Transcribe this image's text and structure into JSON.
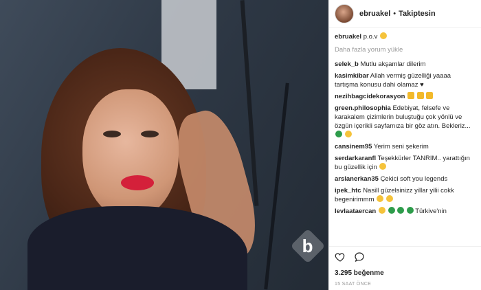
{
  "header": {
    "username": "ebruakel",
    "separator": "•",
    "follow_status": "Takiptesin"
  },
  "caption": {
    "username": "ebruakel",
    "text": "p.o.v"
  },
  "load_more": "Daha fazla yorum yükle",
  "comments": [
    {
      "user": "selek_b",
      "text": "Mutlu akşamlar dilerim"
    },
    {
      "user": "kasimkibar",
      "text": "Allah vermiş güzelliği yaaaa tartışma konusu dahi olamaz ♥"
    },
    {
      "user": "nezihbagcidekorasyon",
      "text": ""
    },
    {
      "user": "green.philosophia",
      "text": "Edebiyat, felsefe ve karakalem çizimlerin buluştuğu çok yönlü ve özgün içerikli sayfamıza bir göz atın. Bekleriz..."
    },
    {
      "user": "cansinem95",
      "text": "Yerim seni şekerim"
    },
    {
      "user": "serdarkaranfl",
      "text": "Teşekkürler TANRIM.. yarattığın bu güzellik için"
    },
    {
      "user": "arslanerkan35",
      "text": "Çekici soft you legends"
    },
    {
      "user": "ipek_htc",
      "text": "Nasill güzelsinizz yillar yilii cokk begenirimmm"
    },
    {
      "user": "levlaataercan",
      "text": "Türkive'nin"
    }
  ],
  "likes": "3.295 beğenme",
  "timestamp": "15 SAAT ÖNCE",
  "watermark": "b",
  "icons": {
    "like": "heart-icon",
    "comment": "comment-icon"
  }
}
